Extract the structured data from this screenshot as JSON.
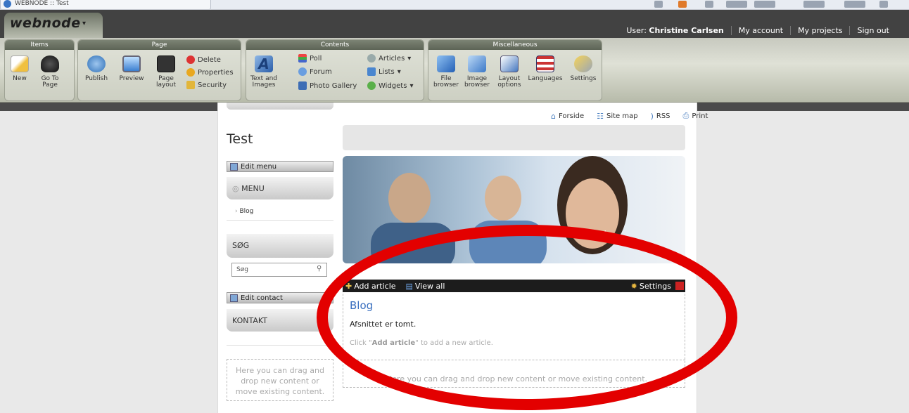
{
  "browser": {
    "tab_title": "WEBNODE :: Test"
  },
  "app": {
    "brand": "webnode",
    "brand_arrow": "▾"
  },
  "user_bar": {
    "user_prefix": "User:",
    "user_name": "Christine Carlsen",
    "my_account": "My account",
    "my_projects": "My projects",
    "sign_out": "Sign out"
  },
  "toolbar": {
    "groups": {
      "items": "Items",
      "page": "Page",
      "contents": "Contents",
      "misc": "Miscellaneous"
    },
    "new": "New",
    "go_to_page": "Go To Page",
    "publish": "Publish",
    "preview": "Preview",
    "page_layout": "Page layout",
    "delete": "Delete",
    "properties": "Properties",
    "security": "Security",
    "text_images": "Text and Images",
    "poll": "Poll",
    "forum": "Forum",
    "photo_gallery": "Photo Gallery",
    "articles": "Articles",
    "lists": "Lists",
    "widgets": "Widgets",
    "file_browser": "File browser",
    "image_browser": "Image browser",
    "layout_options": "Layout options",
    "languages": "Languages",
    "settings": "Settings"
  },
  "site": {
    "links": {
      "home": "Forside",
      "sitemap": "Site map",
      "rss": "RSS",
      "print": "Print"
    },
    "title": "Test",
    "edit_menu": "Edit menu",
    "menu_heading": "MENU",
    "menu_item": "Blog",
    "search_heading": "SØG",
    "search_placeholder": "Søg",
    "edit_contact": "Edit contact",
    "contact_heading": "KONTAKT",
    "drop_left": "Here you can drag and drop new content or move existing content."
  },
  "blog": {
    "add_article": "Add article",
    "view_all": "View all",
    "settings": "Settings",
    "title": "Blog",
    "empty": "Afsnittet er tomt.",
    "hint_prefix": "Click \"",
    "hint_bold": "Add article",
    "hint_suffix": "\" to add a new article.",
    "drop": "Here you can drag and drop new content or move existing content."
  },
  "colors": {
    "highlight": "#e30000",
    "topbar": "#424242",
    "link_blue": "#3a6fbf"
  }
}
